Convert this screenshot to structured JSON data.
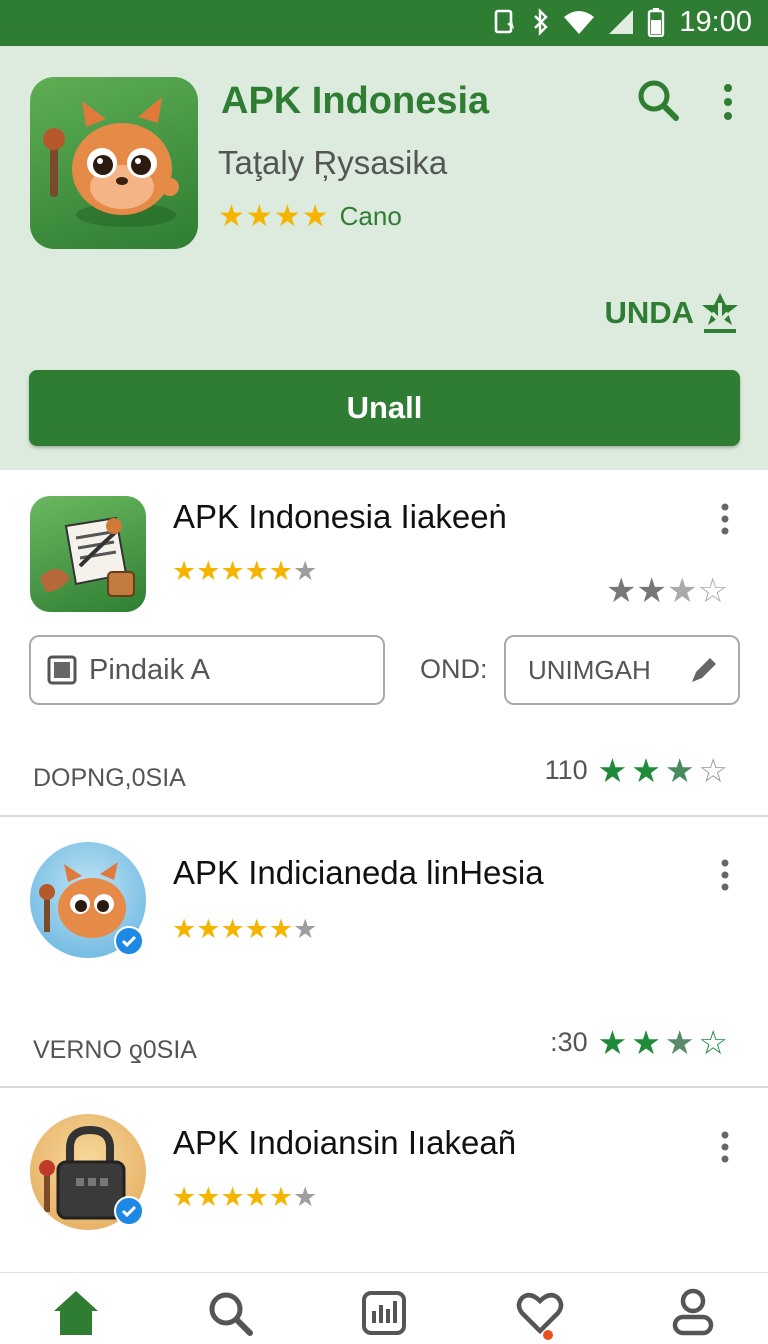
{
  "status_bar": {
    "time": "19:00"
  },
  "hero": {
    "title": "APK Indonesia",
    "subtitle": "Taţaly Ŗysasika",
    "rating_label": "Cano",
    "download_label": "UNDA",
    "install_label": "Unall",
    "star_color": "#f4b400",
    "accent": "#2e7d32"
  },
  "items": [
    {
      "title": "APK Indonesia Iiakeeṅ",
      "rating_stars": 4.5,
      "secondary_rating_stars": 2.5,
      "field_left": "Pindaik A",
      "field_middle": "OND:",
      "field_right": "UNIMGAH",
      "meta_left": "DOPNG,0SIA",
      "meta_count": "110"
    },
    {
      "title": "APK Indicianeda linНesia",
      "rating_stars": 4.5,
      "meta_left": "VERNO ƍ0SIA",
      "meta_count": ":30"
    },
    {
      "title": "APK Indoiansin Iıakeañ",
      "rating_stars": 4.5
    }
  ],
  "nav": [
    "home",
    "search",
    "charts",
    "favorites",
    "profile"
  ]
}
